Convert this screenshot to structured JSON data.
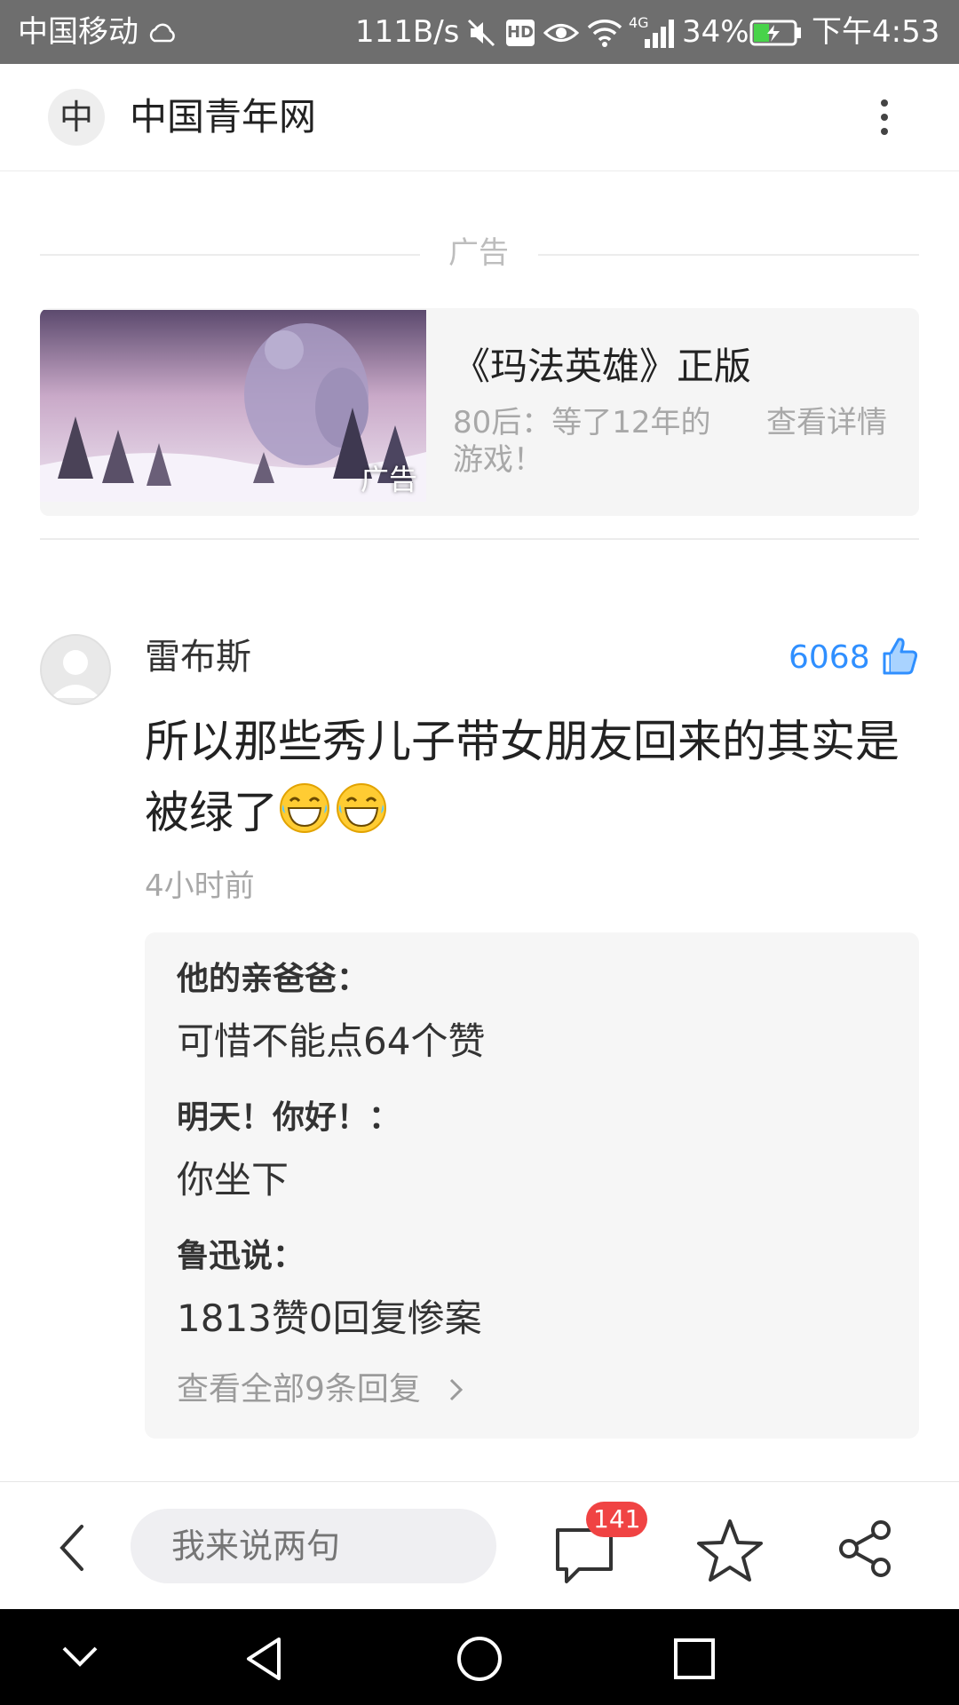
{
  "status_bar": {
    "carrier": "中国移动",
    "speed": "111B/s",
    "hd": "HD",
    "network": "4G",
    "battery": "34%",
    "time": "下午4:53"
  },
  "header": {
    "avatar_char": "中",
    "title": "中国青年网"
  },
  "ad": {
    "section_label": "广告",
    "image_tag": "广告",
    "title": "《玛法英雄》正版",
    "description": "80后：等了12年的游戏！",
    "cta": "查看详情"
  },
  "comment": {
    "username": "雷布斯",
    "like_count": "6068",
    "text": "所以那些秀儿子带女朋友回来的其实是被绿了",
    "emoji": "laughing-tears-emoji",
    "time": "4小时前",
    "replies": [
      {
        "author": "他的亲爸爸：",
        "text": "可惜不能点64个赞"
      },
      {
        "author": "明天！你好！：",
        "text": "你坐下"
      },
      {
        "author": "鲁迅说：",
        "text": "1813赞0回复惨案"
      }
    ],
    "view_all": "查看全部9条回复"
  },
  "action_bar": {
    "input_placeholder": "我来说两句",
    "comment_count": "141"
  },
  "colors": {
    "status_bar_bg": "#6e6e6e",
    "like_blue": "#2f8fff",
    "badge_red": "#f04343"
  }
}
